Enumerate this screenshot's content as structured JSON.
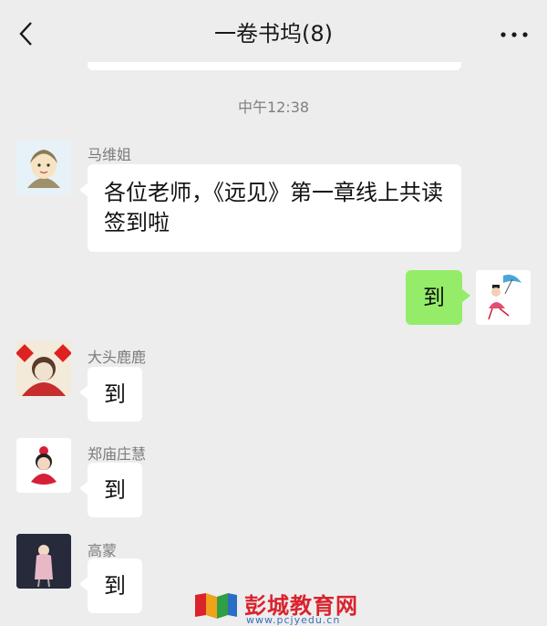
{
  "header": {
    "title": "一卷书坞(8)",
    "back_icon": "chevron-left-icon",
    "more_icon": "more-dots-icon"
  },
  "timestamp": "中午12:38",
  "messages": [
    {
      "sender": "马维姐",
      "text": "各位老师，《远见》第一章线上共读签到啦"
    },
    {
      "sender": "me",
      "text": "到"
    },
    {
      "sender": "大头鹿鹿",
      "text": "到"
    },
    {
      "sender": "郑庙庄慧",
      "text": "到"
    },
    {
      "sender": "高蒙",
      "text": "到"
    }
  ],
  "watermark": {
    "text": "彭城教育网",
    "url": "www.pcjyedu.cn"
  },
  "colors": {
    "background": "#ededed",
    "self_bubble": "#95ec69",
    "other_bubble": "#ffffff",
    "watermark_red": "#d9232d"
  }
}
